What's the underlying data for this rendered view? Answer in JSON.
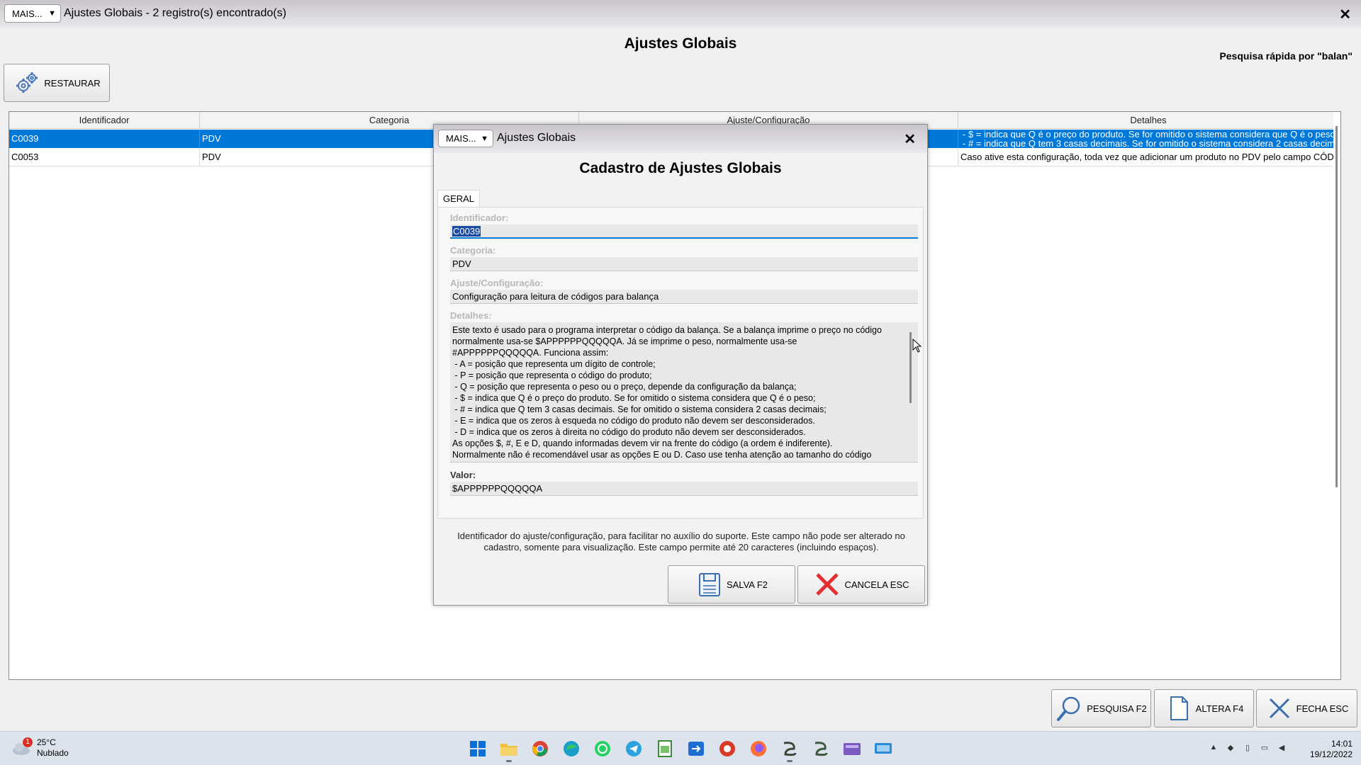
{
  "window": {
    "mais_label": "MAIS...",
    "title": "Ajustes Globais - 2 registro(s) encontrado(s)",
    "close_glyph": "✕"
  },
  "page": {
    "title": "Ajustes Globais",
    "quick_search": "Pesquisa rápida por \"balan\""
  },
  "toolbar": {
    "restaurar_label": "RESTAURAR"
  },
  "grid": {
    "columns": [
      "Identificador",
      "Categoria",
      "Ajuste/Configuração",
      "Detalhes"
    ],
    "rows": [
      {
        "id": "C0039",
        "categoria": "PDV",
        "detalhes_line1": "- $ = indica que Q é o preço do produto. Se for omitido o sistema considera que Q é o peso;",
        "detalhes_line2": "- # = indica que Q tem 3 casas decimais. Se for omitido o sistema considera 2 casas decimais;"
      },
      {
        "id": "C0053",
        "categoria": "PDV",
        "detalhes": "Caso ative esta configuração, toda vez que adicionar um produto no PDV pelo campo CÓDIGO"
      }
    ]
  },
  "bottom_buttons": {
    "pesquisa": "PESQUISA F2",
    "altera": "ALTERA F4",
    "fecha": "FECHA ESC"
  },
  "dialog": {
    "mais_label": "MAIS...",
    "title": "Ajustes Globais",
    "close_glyph": "✕",
    "heading": "Cadastro de Ajustes Globais",
    "tab": "GERAL",
    "fields": {
      "identificador_label": "Identificador:",
      "identificador_value": "C0039",
      "categoria_label": "Categoria:",
      "categoria_value": "PDV",
      "ajuste_label": "Ajuste/Configuração:",
      "ajuste_value": "Configuração para leitura de códigos para balança",
      "detalhes_label": "Detalhes:",
      "detalhes_value": "Este texto é usado para o programa interpretar o código da balança. Se a balança imprime o preço no código\nnormalmente usa-se $APPPPPPQQQQQA. Já se imprime o peso, normalmente usa-se\n#APPPPPPQQQQQA. Funciona assim:\n - A = posição que representa um dígito de controle;\n - P = posição que representa o código do produto;\n - Q = posição que representa o peso ou o preço, depende da configuração da balança;\n - $ = indica que Q é o preço do produto. Se for omitido o sistema considera que Q é o peso;\n - # = indica que Q tem 3 casas decimais. Se for omitido o sistema considera 2 casas decimais;\n - E = indica que os zeros à esqueda no código do produto não devem ser desconsiderados.\n - D = indica que os zeros à direita no código do produto não devem ser desconsiderados.\nAs opções $, #, E e D, quando informadas devem vir na frente do código (a ordem é indiferente).\nNormalmente não é recomendável usar as opções E ou D. Caso use tenha atenção ao tamanho do código",
      "valor_label": "Valor:",
      "valor_value": "$APPPPPPQQQQQA"
    },
    "help_text": "Identificador do ajuste/configuração, para facilitar no auxílio do suporte. Este campo não pode ser alterado no cadastro, somente para visualização. Este campo permite até 20 caracteres (incluindo espaços).",
    "salva_label": "SALVA F2",
    "cancela_label": "CANCELA ESC"
  },
  "taskbar": {
    "weather_temp": "25°C",
    "weather_desc": "Nublado",
    "weather_badge": "1",
    "time": "14:01",
    "date": "19/12/2022",
    "apps": [
      "start-icon",
      "file-explorer-icon",
      "chrome-icon",
      "edge-icon",
      "whatsapp-icon",
      "telegram-icon",
      "spreadsheet-icon",
      "remote-access-icon",
      "app-red-icon",
      "firefox-icon",
      "erp-app-icon",
      "erp-app-2-icon",
      "video-editor-icon",
      "monitor-app-icon"
    ]
  },
  "colors": {
    "selection": "#0078d7",
    "title_gradient_top": "#c9c5cc",
    "cancel_red": "#e03030"
  }
}
